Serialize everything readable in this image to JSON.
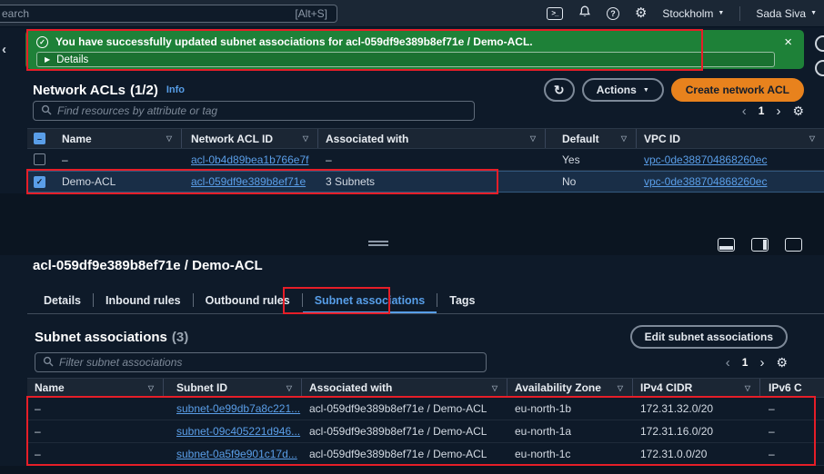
{
  "icons": {
    "check": "✓",
    "close": "×",
    "details_arrow": "▶",
    "refresh": "↻",
    "dropdown": "▼",
    "sort": "▽",
    "prev": "‹",
    "next": "›",
    "gear": "⚙",
    "help": "?",
    "cloudshell": ">_",
    "minus": "–"
  },
  "topbar": {
    "search_partial": "earch",
    "search_shortcut": "[Alt+S]",
    "region": "Stockholm",
    "user": "Sada Siva"
  },
  "banner": {
    "message": "You have successfully updated subnet associations for acl-059df9e389b8ef71e / Demo-ACL.",
    "details_label": "Details"
  },
  "acl_section": {
    "title": "Network ACLs",
    "count": "(1/2)",
    "info_label": "Info",
    "actions_label": "Actions",
    "create_label": "Create network ACL",
    "search_placeholder": "Find resources by attribute or tag",
    "page": "1",
    "columns": [
      "Name",
      "Network ACL ID",
      "Associated with",
      "Default",
      "VPC ID"
    ],
    "rows": [
      {
        "name": "–",
        "acl_id": "acl-0b4d89bea1b766e7f",
        "associated": "–",
        "default": "Yes",
        "vpc": "vpc-0de388704868260ec",
        "selected": false
      },
      {
        "name": "Demo-ACL",
        "acl_id": "acl-059df9e389b8ef71e",
        "associated": "3 Subnets",
        "default": "No",
        "vpc": "vpc-0de388704868260ec",
        "selected": true
      }
    ]
  },
  "detail": {
    "title": "acl-059df9e389b8ef71e / Demo-ACL",
    "tabs": [
      "Details",
      "Inbound rules",
      "Outbound rules",
      "Subnet associations",
      "Tags"
    ],
    "active_tab": "Subnet associations"
  },
  "subnet_section": {
    "title": "Subnet associations",
    "count": "(3)",
    "edit_label": "Edit subnet associations",
    "filter_placeholder": "Filter subnet associations",
    "page": "1",
    "columns": [
      "Name",
      "Subnet ID",
      "Associated with",
      "Availability Zone",
      "IPv4 CIDR",
      "IPv6 C"
    ],
    "rows": [
      {
        "name": "–",
        "subnet_id": "subnet-0e99db7a8c221...",
        "associated": "acl-059df9e389b8ef71e / Demo-ACL",
        "az": "eu-north-1b",
        "ipv4": "172.31.32.0/20",
        "ipv6": "–"
      },
      {
        "name": "–",
        "subnet_id": "subnet-09c405221d946...",
        "associated": "acl-059df9e389b8ef71e / Demo-ACL",
        "az": "eu-north-1a",
        "ipv4": "172.31.16.0/20",
        "ipv6": "–"
      },
      {
        "name": "–",
        "subnet_id": "subnet-0a5f9e901c17d...",
        "associated": "acl-059df9e389b8ef71e / Demo-ACL",
        "az": "eu-north-1c",
        "ipv4": "172.31.0.0/20",
        "ipv6": "–"
      }
    ]
  }
}
